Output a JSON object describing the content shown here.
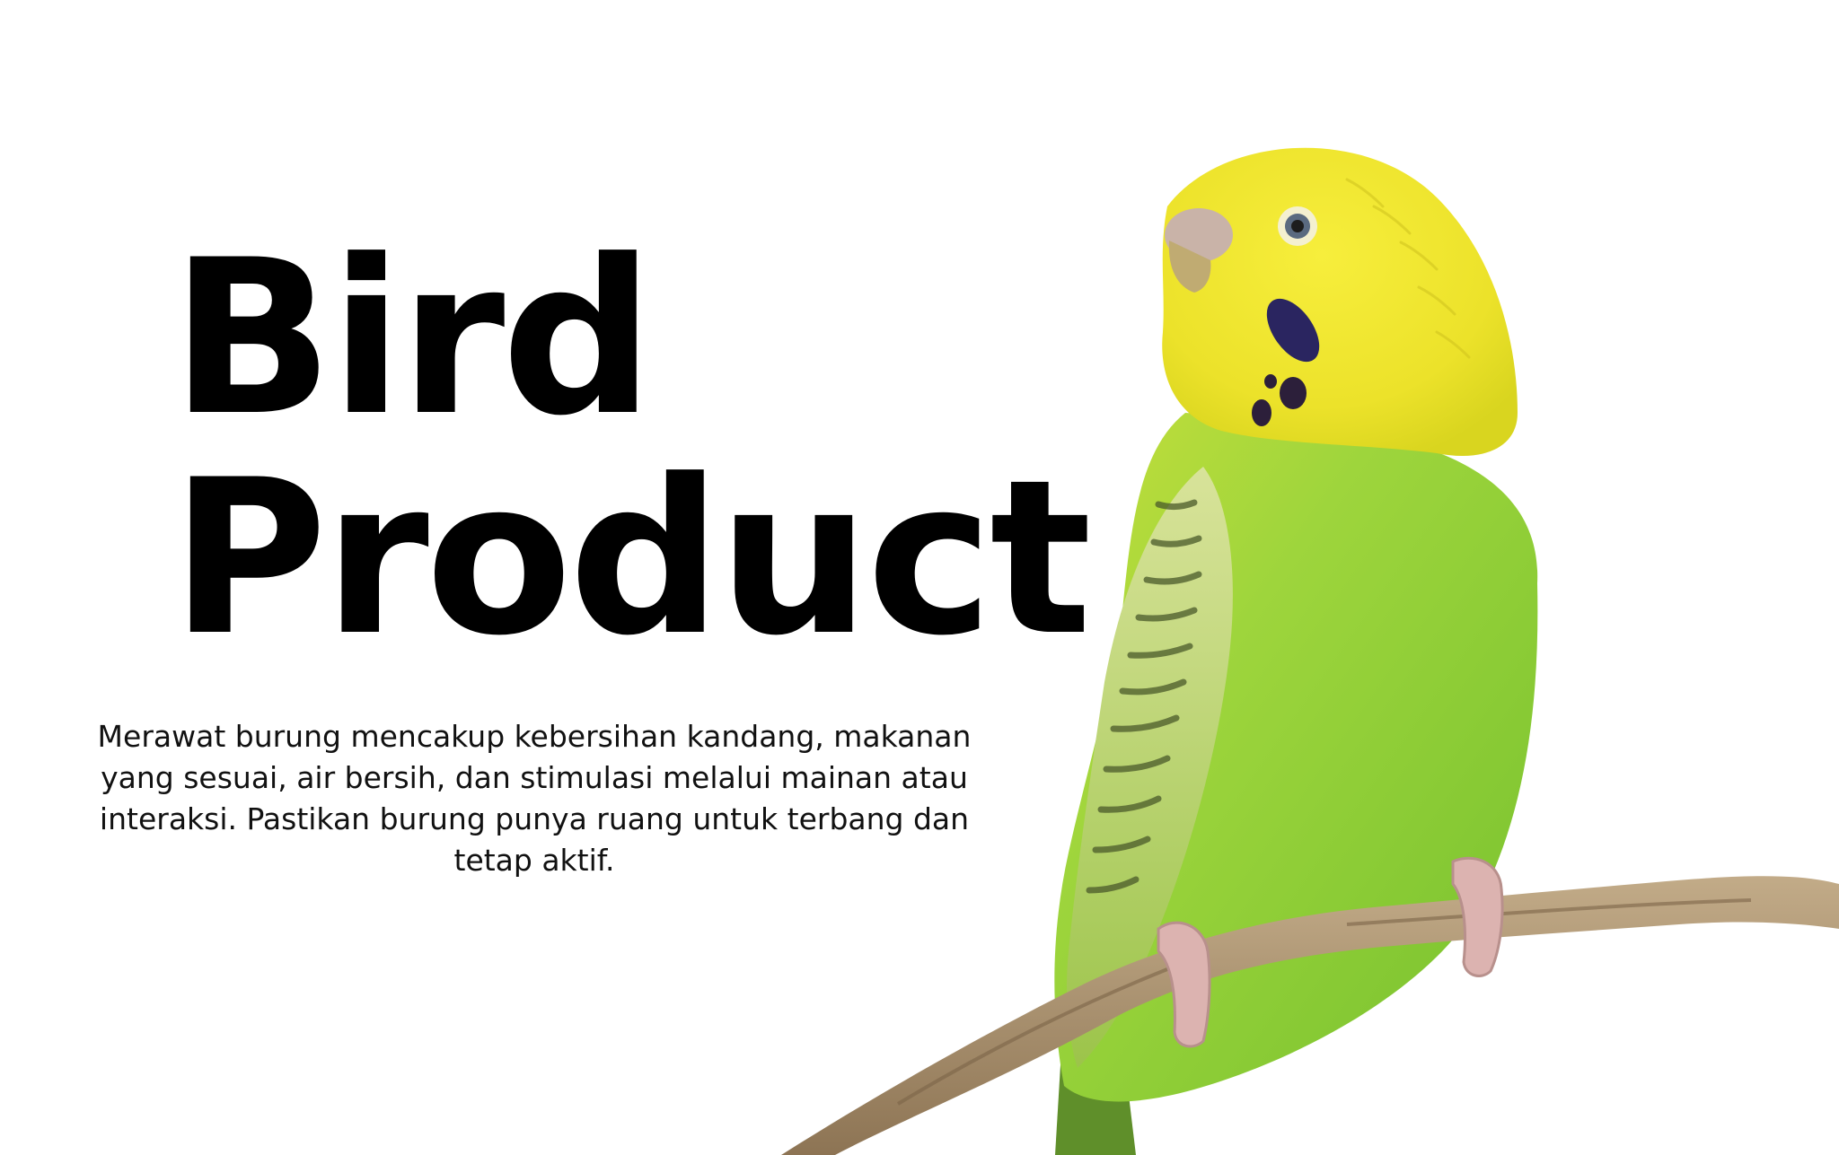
{
  "hero": {
    "title_line1": "Bird",
    "title_line2": "Product",
    "description": "Merawat burung mencakup kebersihan kandang, makanan yang sesuai, air bersih, dan stimulasi melalui mainan atau interaksi. Pastikan burung punya ruang untuk terbang dan tetap aktif."
  },
  "colors": {
    "background": "#ffffff",
    "text": "#000000",
    "bird_head": "#f2e629",
    "bird_body": "#8fd13a",
    "branch": "#a88e6b"
  }
}
